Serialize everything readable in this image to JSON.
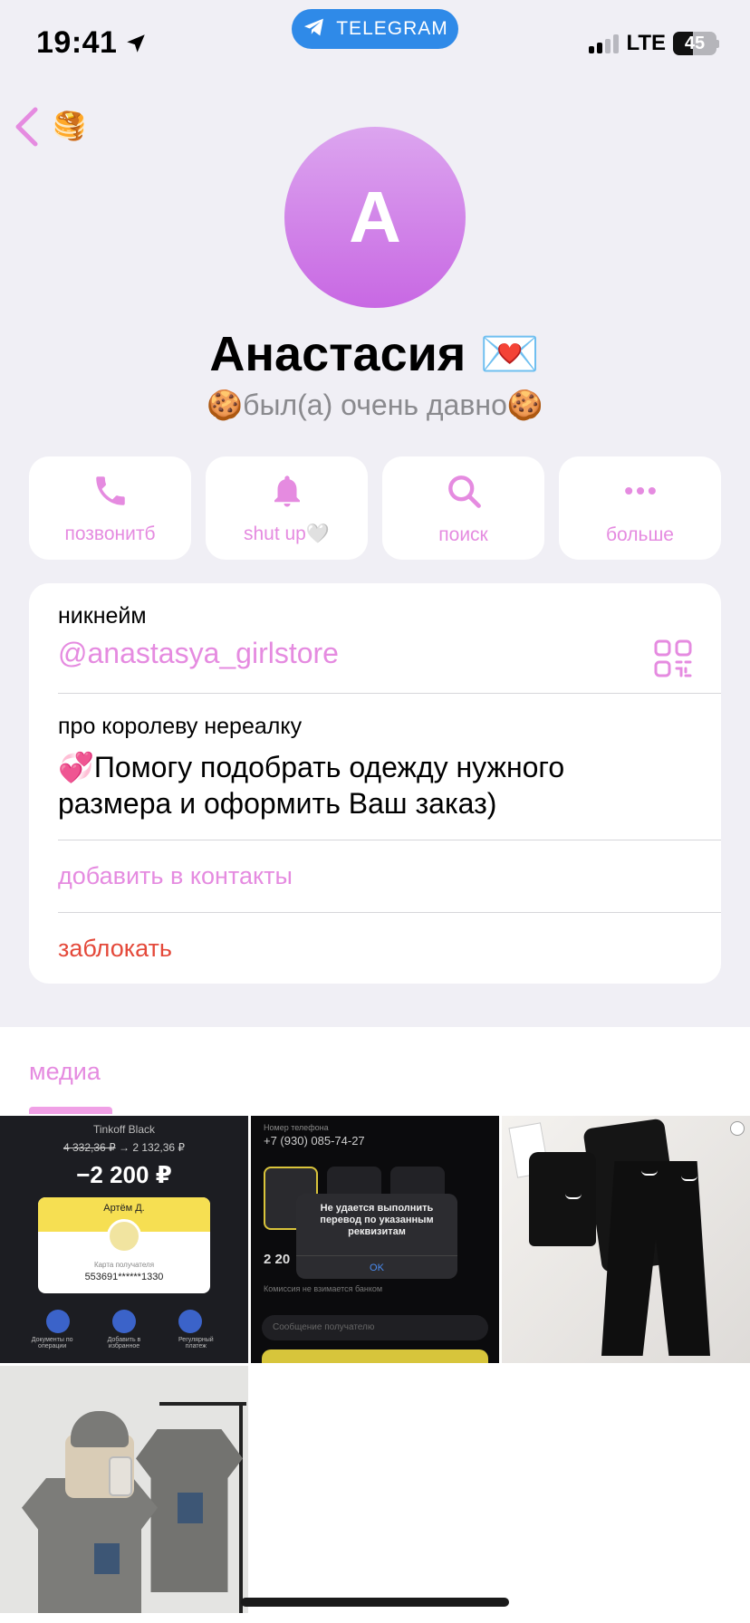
{
  "status_bar": {
    "time": "19:41",
    "app_pill": "TELEGRAM",
    "network": "LTE",
    "battery": "45",
    "battery_level_percent": 45
  },
  "nav": {
    "back_icon": "chevron-left-icon",
    "folder_emoji": "🥞"
  },
  "profile": {
    "avatar_letter": "А",
    "name": "Анастасия 💌",
    "status": "🍪был(а) очень давно🍪"
  },
  "actions": [
    {
      "label": "позвонитб",
      "icon": "phone-icon"
    },
    {
      "label": "shut up🤍",
      "icon": "bell-icon"
    },
    {
      "label": "поиск",
      "icon": "search-icon"
    },
    {
      "label": "больше",
      "icon": "more-icon"
    }
  ],
  "info": {
    "nickname_label": "никнейм",
    "nickname_value": "@anastasya_girlstore",
    "bio_label": "про королеву нереалку",
    "bio_text_line1": "💞Помогу подобрать одежду нужного",
    "bio_text_line2": "размера и оформить Ваш заказ)",
    "add_contact": "добавить в контакты",
    "block": "заблокать"
  },
  "media": {
    "tab_label": "медиа",
    "tile1": {
      "header": "Tinkoff Black",
      "old_amount": "4 332,36 ₽",
      "new_amount": "2 132,36 ₽",
      "arrow": "→",
      "big_amount": "−2 200 ₽",
      "recipient": "Артём Д.",
      "card_label": "Карта получателя",
      "card_number": "553691******1330",
      "cap1": "Документы по операции",
      "cap2": "Добавить в избранное",
      "cap3": "Регулярный платеж"
    },
    "tile2": {
      "phone_label": "Номер телефона",
      "phone": "+7 (930) 085-74-27",
      "dialog": "Не удается выполнить перевод по указанным реквизитам",
      "ok": "OK",
      "amount": "2 20",
      "commission": "Комиссия не взимается банком",
      "input_placeholder": "Сообщение получателю"
    }
  },
  "colors": {
    "accent": "#e58be0",
    "danger": "#e4493a",
    "telegram_blue": "#2f8ae8",
    "background": "#f0eff5"
  }
}
